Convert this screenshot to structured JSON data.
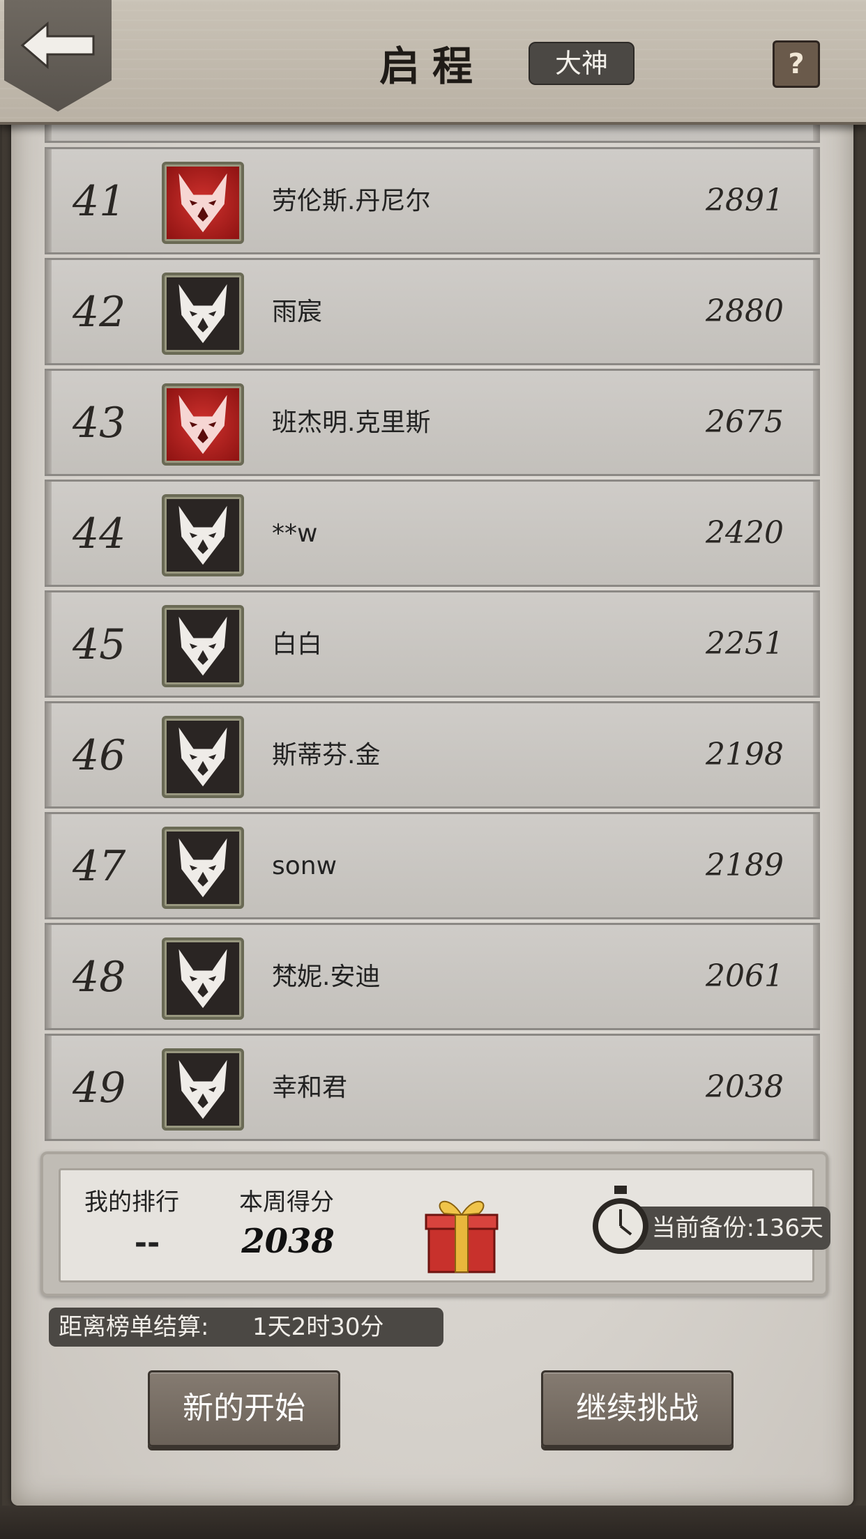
{
  "header": {
    "title": "启程",
    "difficulty_badge": "大神",
    "help_label": "?"
  },
  "leaderboard": [
    {
      "rank": "41",
      "name": "劳伦斯.丹尼尔",
      "score": "2891",
      "avatar": "red-wolf-icon"
    },
    {
      "rank": "42",
      "name": "雨宸",
      "score": "2880",
      "avatar": "dark-wolf-icon"
    },
    {
      "rank": "43",
      "name": "班杰明.克里斯",
      "score": "2675",
      "avatar": "red-wolf-icon"
    },
    {
      "rank": "44",
      "name": "**w",
      "score": "2420",
      "avatar": "dark-wolf-icon"
    },
    {
      "rank": "45",
      "name": "白白",
      "score": "2251",
      "avatar": "dark-wolf-icon"
    },
    {
      "rank": "46",
      "name": "斯蒂芬.金",
      "score": "2198",
      "avatar": "dark-wolf-icon"
    },
    {
      "rank": "47",
      "name": "sonw",
      "score": "2189",
      "avatar": "dark-wolf-icon"
    },
    {
      "rank": "48",
      "name": "梵妮.安迪",
      "score": "2061",
      "avatar": "dark-wolf-icon"
    },
    {
      "rank": "49",
      "name": "幸和君",
      "score": "2038",
      "avatar": "dark-wolf-icon"
    }
  ],
  "stats": {
    "my_rank_label": "我的排行",
    "my_rank_value": "--",
    "week_score_label": "本周得分",
    "week_score_value": "2038",
    "backup_label": "当前备份:136天"
  },
  "countdown": {
    "label": "距离榜单结算:",
    "value": "1天2时30分"
  },
  "buttons": {
    "new_start": "新的开始",
    "continue": "继续挑战"
  },
  "colors": {
    "red_avatar": "#b3201d",
    "dark_avatar": "#2a2523",
    "button": "#7a7066"
  }
}
